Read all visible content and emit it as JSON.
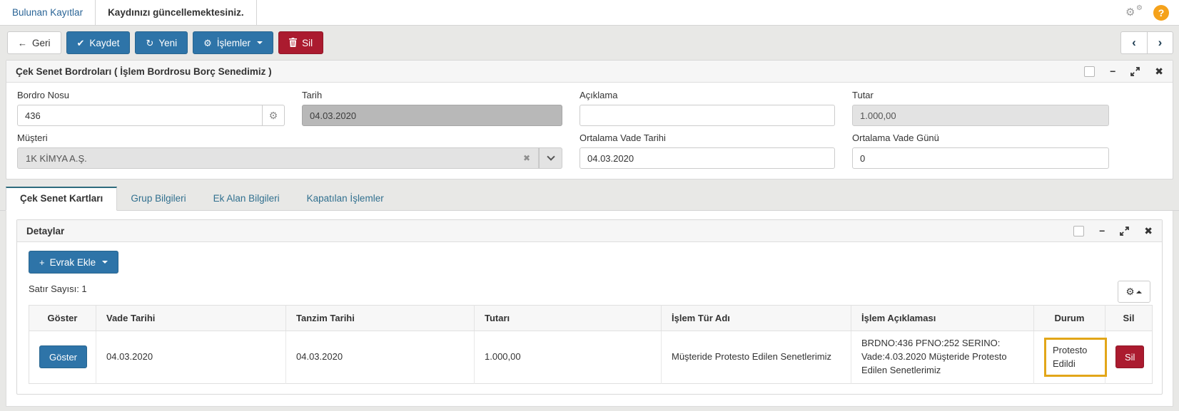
{
  "topbar": {
    "tabs": [
      {
        "label": "Bulunan Kayıtlar",
        "active": false
      },
      {
        "label": "Kaydınızı güncellemektesiniz.",
        "active": true
      }
    ]
  },
  "toolbar": {
    "back": "Geri",
    "save": "Kaydet",
    "new": "Yeni",
    "operations": "İşlemler",
    "delete": "Sil"
  },
  "main_panel": {
    "title": "Çek Senet Bordroları ( İşlem Bordrosu Borç Senedimiz )",
    "fields": {
      "bordro_nosu": {
        "label": "Bordro Nosu",
        "value": "436"
      },
      "tarih": {
        "label": "Tarih",
        "value": "04.03.2020",
        "disabled": true
      },
      "aciklama": {
        "label": "Açıklama",
        "value": ""
      },
      "tutar": {
        "label": "Tutar",
        "value": "1.000,00",
        "disabled": true
      },
      "musteri": {
        "label": "Müşteri",
        "value": "1K KİMYA A.Ş.",
        "disabled": true
      },
      "ortalama_vade_tarihi": {
        "label": "Ortalama Vade Tarihi",
        "value": "04.03.2020"
      },
      "ortalama_vade_gunu": {
        "label": "Ortalama Vade Günü",
        "value": "0"
      }
    }
  },
  "subtabs": [
    {
      "label": "Çek Senet Kartları",
      "active": true
    },
    {
      "label": "Grup Bilgileri",
      "active": false
    },
    {
      "label": "Ek Alan Bilgileri",
      "active": false
    },
    {
      "label": "Kapatılan İşlemler",
      "active": false
    }
  ],
  "details": {
    "title": "Detaylar",
    "add_document": "Evrak Ekle",
    "row_count": "Satır Sayısı: 1",
    "table": {
      "headers": [
        "Göster",
        "Vade Tarihi",
        "Tanzim Tarihi",
        "Tutarı",
        "İşlem Tür Adı",
        "İşlem Açıklaması",
        "Durum",
        "Sil"
      ],
      "row": {
        "show_label": "Göster",
        "vade_tarihi": "04.03.2020",
        "tanzim_tarihi": "04.03.2020",
        "tutari": "1.000,00",
        "islem_tur_adi": "Müşteride Protesto Edilen Senetlerimiz",
        "islem_aciklamasi": "BRDNO:436 PFNO:252 SERINO: Vade:4.03.2020 Müşteride Protesto Edilen Senetlerimiz",
        "durum": "Protesto Edildi",
        "delete_label": "Sil"
      }
    }
  },
  "icons": {
    "back": "←",
    "save": "✔",
    "new": "↻",
    "operations": "⚙",
    "prev": "‹",
    "next": "›",
    "help": "?",
    "settings": "⚙",
    "settings_small": "⚙",
    "minimize": "−",
    "close": "✖",
    "field_gear": "⚙",
    "clear": "✖",
    "add": "+",
    "table_gear": "⚙"
  },
  "colors": {
    "primary_blue": "#2e74a8",
    "danger_red": "#ab1b2f",
    "help_orange": "#f5a21b",
    "active_tab_accent": "#2e6b7d",
    "highlight_yellow": "#e2a619",
    "disabled_dark_gray": "#b8b8b8",
    "disabled_light_gray": "#e3e3e3",
    "page_background": "#e8e8e6"
  }
}
